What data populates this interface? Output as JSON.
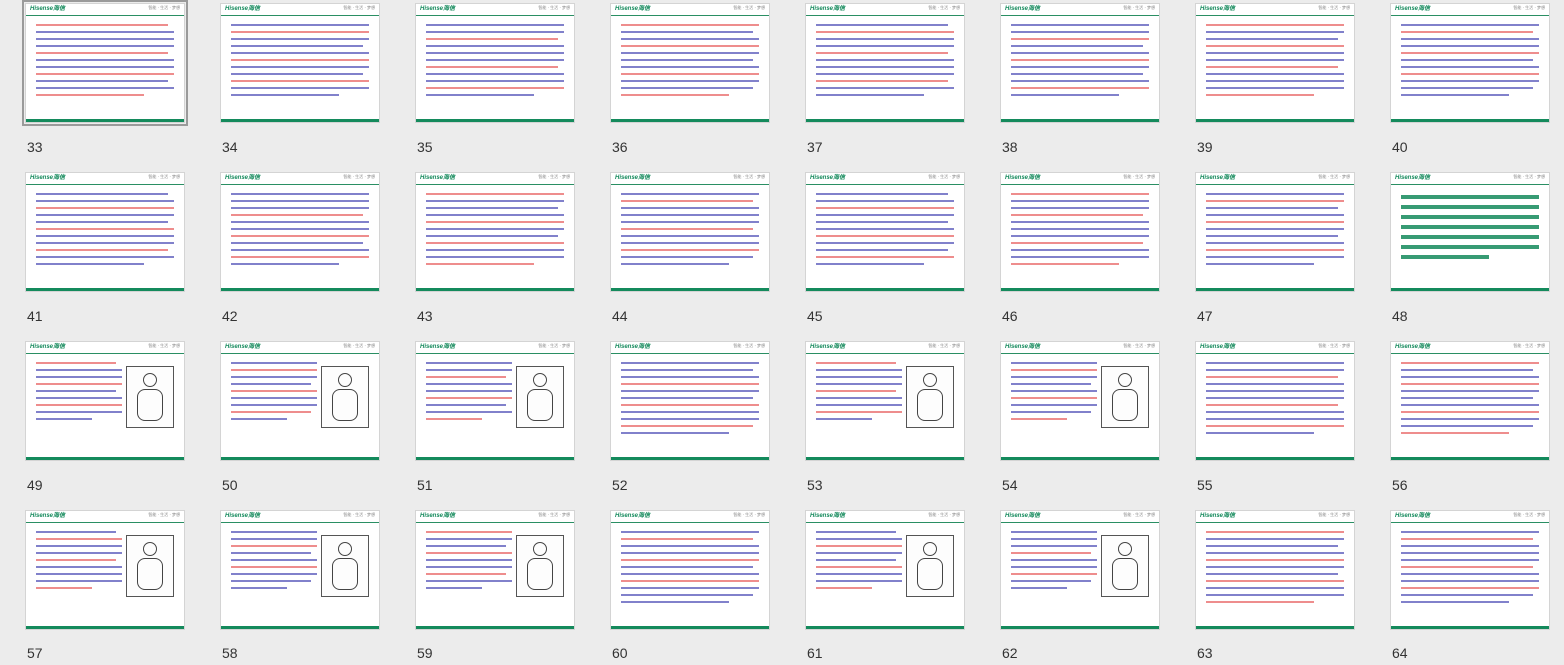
{
  "brand": {
    "logo_text": "Hisense海信",
    "tagline": "智能 · 生活 · 梦想"
  },
  "colors": {
    "accent": "#148a5c",
    "text_dark": "#1a1aa0",
    "text_red": "#e03030",
    "number": "#333333"
  },
  "slides": [
    {
      "number": "33",
      "selected": true
    },
    {
      "number": "34"
    },
    {
      "number": "35"
    },
    {
      "number": "36"
    },
    {
      "number": "37"
    },
    {
      "number": "38"
    },
    {
      "number": "39"
    },
    {
      "number": "40"
    },
    {
      "number": "41"
    },
    {
      "number": "42"
    },
    {
      "number": "43"
    },
    {
      "number": "44"
    },
    {
      "number": "45"
    },
    {
      "number": "46"
    },
    {
      "number": "47"
    },
    {
      "number": "48"
    },
    {
      "number": "49"
    },
    {
      "number": "50"
    },
    {
      "number": "51"
    },
    {
      "number": "52"
    },
    {
      "number": "53"
    },
    {
      "number": "54"
    },
    {
      "number": "55"
    },
    {
      "number": "56"
    },
    {
      "number": "57"
    },
    {
      "number": "58"
    },
    {
      "number": "59"
    },
    {
      "number": "60"
    },
    {
      "number": "61"
    },
    {
      "number": "62"
    },
    {
      "number": "63"
    },
    {
      "number": "64"
    }
  ]
}
